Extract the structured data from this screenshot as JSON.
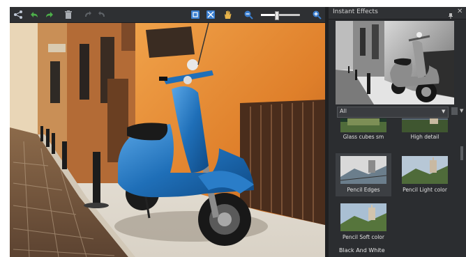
{
  "toolbar": {
    "items": [
      "share-icon",
      "undo-icon",
      "redo-icon",
      "delete-icon",
      "rotate-left-icon",
      "rotate-right-icon",
      "fit-window-icon",
      "actual-size-icon",
      "pan-hand-icon",
      "zoom-out-icon",
      "zoom-in-icon"
    ],
    "zoom_level": 0.4
  },
  "colors": {
    "accent": "#3b7fd0",
    "panel_bg": "#2b2d30",
    "scooter": "#1f6fb8",
    "wall": "#e0862e"
  },
  "panel": {
    "title": "Instant Effects",
    "filter": {
      "selected": "All"
    },
    "effects": [
      {
        "label": "Glass cubes sm",
        "selected": false
      },
      {
        "label": "High detail",
        "selected": false
      },
      {
        "label": "Pencil Edges",
        "selected": true
      },
      {
        "label": "Pencil Light color",
        "selected": false
      },
      {
        "label": "Pencil Soft color",
        "selected": false
      }
    ],
    "category_footer": "Black And White"
  }
}
